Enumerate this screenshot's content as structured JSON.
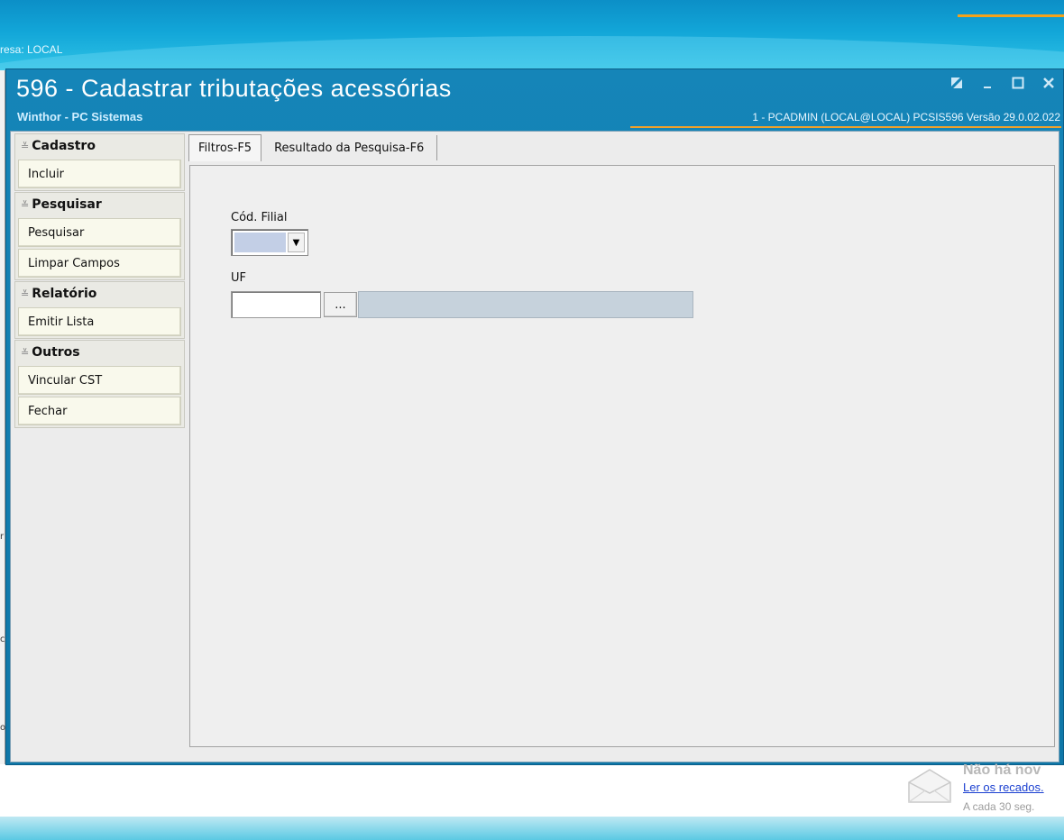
{
  "background": {
    "empresa_label": "resa: LOCAL"
  },
  "window": {
    "title": "596 - Cadastrar tributações acessórias",
    "subtitle": "Winthor - PC Sistemas",
    "status": "1 - PCADMIN (LOCAL@LOCAL)  PCSIS596  Versão  29.0.02.022",
    "controls": [
      "restore-icon",
      "minimize-icon",
      "maximize-icon",
      "close-icon"
    ]
  },
  "sidebar": {
    "groups": [
      {
        "header": "Cadastro",
        "actions": [
          "Incluir"
        ]
      },
      {
        "header": "Pesquisar",
        "actions": [
          "Pesquisar",
          "Limpar Campos"
        ]
      },
      {
        "header": "Relatório",
        "actions": [
          "Emitir Lista"
        ]
      },
      {
        "header": "Outros",
        "actions": [
          "Vincular CST",
          "Fechar"
        ]
      }
    ]
  },
  "tabs": [
    {
      "label": "Filtros-F5",
      "active": true
    },
    {
      "label": "Resultado da Pesquisa-F6",
      "active": false
    }
  ],
  "filters": {
    "cod_filial_label": "Cód. Filial",
    "cod_filial_value": "",
    "uf_label": "UF",
    "uf_value": "",
    "uf_lookup_label": "...",
    "uf_description": ""
  },
  "recados": {
    "status": "Não há nov",
    "link": "Ler os recados.",
    "interval": "A cada 30 seg."
  }
}
